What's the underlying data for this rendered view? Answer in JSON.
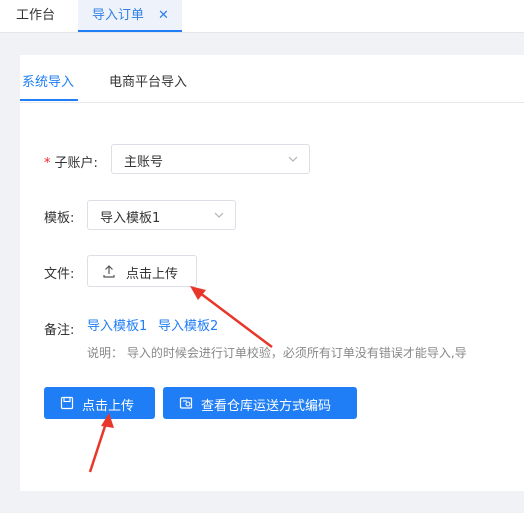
{
  "header": {
    "tabs": [
      {
        "label": "工作台"
      },
      {
        "label": "导入订单",
        "close": "✕"
      }
    ]
  },
  "subtabs": [
    {
      "label": "系统导入",
      "active": true
    },
    {
      "label": "电商平台导入",
      "active": false
    }
  ],
  "form": {
    "account": {
      "required_mark": "*",
      "label": "子账户:",
      "value": "主账号"
    },
    "template": {
      "label": "模板:",
      "value": "导入模板1"
    },
    "file": {
      "label": "文件:",
      "button": "点击上传"
    },
    "remark": {
      "label": "备注:",
      "links": [
        "导入模板1",
        "导入模板2"
      ],
      "hint": "说明： 导入的时候会进行订单校验，必须所有订单没有错误才能导入,导"
    }
  },
  "actions": {
    "upload": "点击上传",
    "view_codes": "查看仓库运送方式编码"
  },
  "colors": {
    "primary": "#1f7ef5",
    "annotation_arrow": "#e8362a"
  }
}
